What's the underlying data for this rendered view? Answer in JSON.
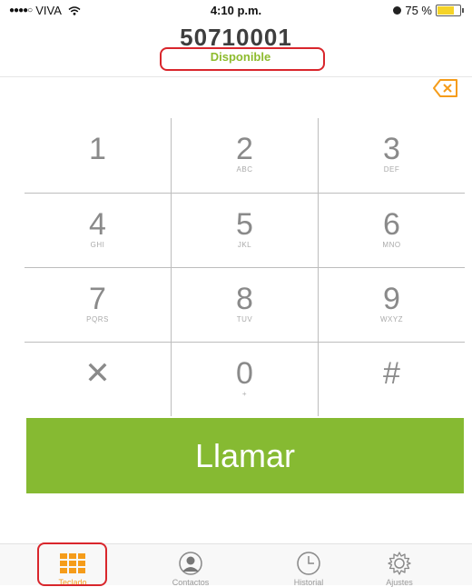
{
  "status_bar": {
    "carrier": "VIVA",
    "signal": "●●●●○",
    "time": "4:10 p.m.",
    "battery_percent": "75 %",
    "battery_level": 0.75
  },
  "header": {
    "phone_number": "50710001",
    "status": "Disponible"
  },
  "keypad": {
    "keys": [
      {
        "digit": "1",
        "letters": ""
      },
      {
        "digit": "2",
        "letters": "ABC"
      },
      {
        "digit": "3",
        "letters": "DEF"
      },
      {
        "digit": "4",
        "letters": "GHI"
      },
      {
        "digit": "5",
        "letters": "JKL"
      },
      {
        "digit": "6",
        "letters": "MNO"
      },
      {
        "digit": "7",
        "letters": "PQRS"
      },
      {
        "digit": "8",
        "letters": "TUV"
      },
      {
        "digit": "9",
        "letters": "WXYZ"
      },
      {
        "digit": "✕",
        "letters": ""
      },
      {
        "digit": "0",
        "letters": "+"
      },
      {
        "digit": "#",
        "letters": ""
      }
    ]
  },
  "call_button": {
    "label": "Llamar"
  },
  "tab_bar": {
    "tabs": [
      {
        "label": "Teclado",
        "icon": "keypad-icon",
        "active": true
      },
      {
        "label": "Contactos",
        "icon": "contact-icon",
        "active": false
      },
      {
        "label": "Historial",
        "icon": "clock-icon",
        "active": false
      },
      {
        "label": "Ajustes",
        "icon": "gear-icon",
        "active": false
      }
    ]
  },
  "colors": {
    "accent_green": "#86ba32",
    "status_green": "#8dbb2d",
    "active_orange": "#f59c1a",
    "highlight_red": "#d9262c"
  }
}
